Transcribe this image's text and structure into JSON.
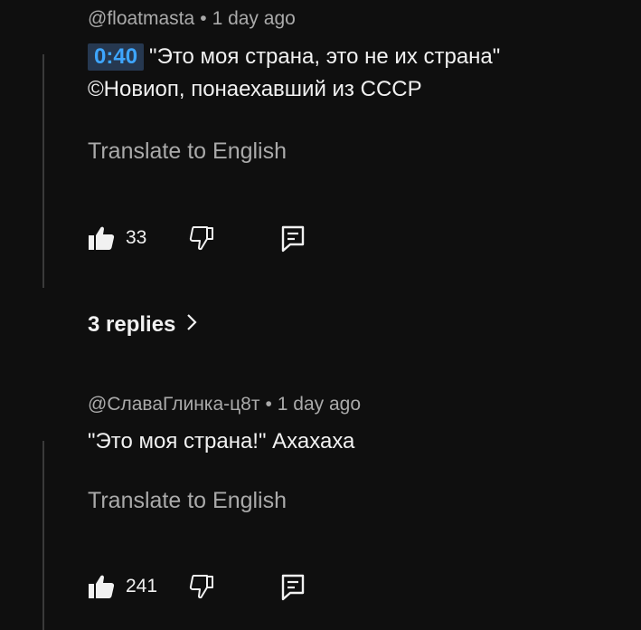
{
  "comments": [
    {
      "author": "@floatmasta",
      "time": "1 day ago",
      "timestamp_link": "0:40",
      "text_line1": "\"Это моя страна, это не их страна\"",
      "text_line2": "©Новиоп, понаехавший из СССР",
      "translate_label": "Translate to English",
      "likes": "33",
      "replies_label": "3 replies"
    },
    {
      "author": "@СлаваГлинка-ц8т",
      "time": "1 day ago",
      "text": "\"Это моя страна!\" Ахахаха",
      "translate_label": "Translate to English",
      "likes": "241"
    }
  ],
  "meta_separator": "•",
  "icons": {
    "like": "thumbs-up-icon",
    "dislike": "thumbs-down-icon",
    "reply": "comment-reply-icon",
    "replies_chevron": "chevron-right-icon"
  },
  "colors": {
    "background": "#0f0f0f",
    "primary_text": "#f1f1f1",
    "secondary_text": "#aaaaaa",
    "timestamp_link": "#3ea6ff",
    "timestamp_bg": "#263850"
  }
}
